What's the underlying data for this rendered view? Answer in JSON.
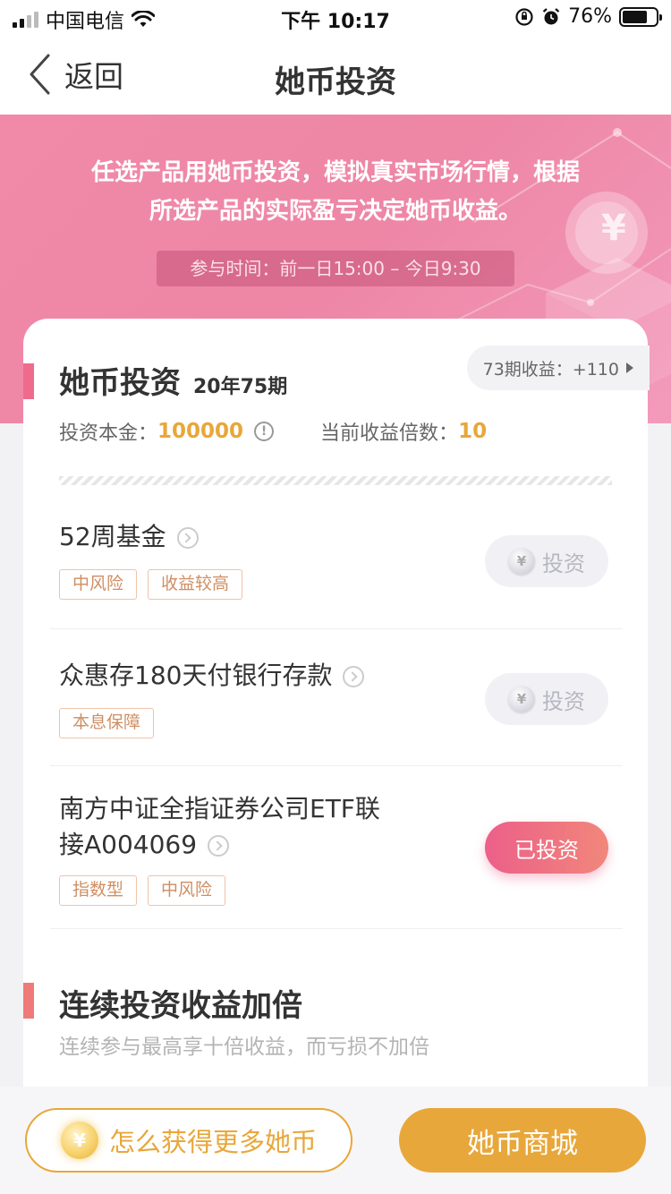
{
  "status_bar": {
    "carrier": "中国电信",
    "time": "下午 10:17",
    "battery_percent": "76%",
    "battery_level": 0.76
  },
  "nav": {
    "back_label": "返回",
    "title": "她币投资"
  },
  "banner": {
    "line1": "任选产品用她币投资，模拟真实市场行情，根据",
    "line2": "所选产品的实际盈亏决定她币收益。",
    "time": "参与时间：前一日15:00 – 今日9:30",
    "coin_symbol": "¥"
  },
  "card": {
    "title": "她币投资",
    "period": "20年75期",
    "prev_earnings": "73期收益：+110",
    "principal_label": "投资本金：",
    "principal_value": "100000",
    "info_icon": "!",
    "multiplier_label": "当前收益倍数：",
    "multiplier_value": "10"
  },
  "products": [
    {
      "name": "52周基金",
      "name_line2": "",
      "tags": [
        "中风险",
        "收益较高"
      ],
      "button": "投资",
      "invested": false
    },
    {
      "name": "众惠存180天付银行存款",
      "name_line2": "",
      "tags": [
        "本息保障"
      ],
      "button": "投资",
      "invested": false
    },
    {
      "name": "南方中证全指证券公司ETF联",
      "name_line2": "接A004069",
      "tags": [
        "指数型",
        "中风险"
      ],
      "button": "已投资",
      "invested": true
    }
  ],
  "coin_symbol": "¥",
  "section2": {
    "title": "连续投资收益加倍",
    "subtitle": "连续参与最高享十倍收益，而亏损不加倍"
  },
  "bottom": {
    "earn_more": "怎么获得更多她币",
    "mall": "她币商城"
  },
  "colors": {
    "pink": "#ef6b8c",
    "gold": "#e8a73a",
    "banner": "#ee86a6"
  }
}
